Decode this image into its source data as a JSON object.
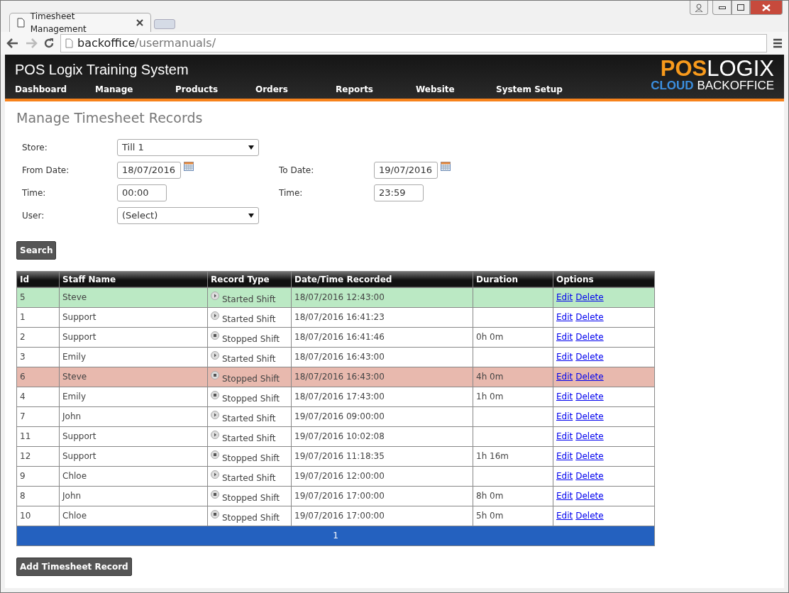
{
  "browser": {
    "tab_title": "Timesheet Management",
    "url_host": "backoffice",
    "url_path": "/usermanuals/"
  },
  "header": {
    "title": "POS Logix Training System",
    "logo": {
      "word_1": "POS",
      "word_2": "LOGIX",
      "word_3": "CLOUD",
      "word_4": "BACKOFFICE"
    },
    "nav": [
      "Dashboard",
      "Manage",
      "Products",
      "Orders",
      "Reports",
      "Website",
      "System Setup"
    ]
  },
  "page_title": "Manage Timesheet Records",
  "filters": {
    "store": {
      "label": "Store:",
      "value": "Till 1"
    },
    "from_date": {
      "label": "From Date:",
      "value": "18/07/2016"
    },
    "to_date": {
      "label": "To Date:",
      "value": "19/07/2016"
    },
    "from_time": {
      "label": "Time:",
      "value": "00:00"
    },
    "to_time": {
      "label": "Time:",
      "value": "23:59"
    },
    "user": {
      "label": "User:",
      "value": "(Select)"
    }
  },
  "search_button": "Search",
  "table": {
    "columns": [
      "Id",
      "Staff Name",
      "Record Type",
      "Date/Time Recorded",
      "Duration",
      "Options"
    ],
    "rows": [
      {
        "id": "5",
        "name": "Steve",
        "kind": "started",
        "type": "Started Shift",
        "recorded": "18/07/2016 12:43:00",
        "duration": "",
        "color": "#bbe9c4",
        "edit": "Edit",
        "delete": "Delete"
      },
      {
        "id": "1",
        "name": "Support",
        "kind": "started",
        "type": "Started Shift",
        "recorded": "18/07/2016 16:41:23",
        "duration": "",
        "color": "#ffffff",
        "edit": "Edit",
        "delete": "Delete"
      },
      {
        "id": "2",
        "name": "Support",
        "kind": "stopped",
        "type": "Stopped Shift",
        "recorded": "18/07/2016 16:41:46",
        "duration": "0h 0m",
        "color": "#ffffff",
        "edit": "Edit",
        "delete": "Delete"
      },
      {
        "id": "3",
        "name": "Emily",
        "kind": "started",
        "type": "Started Shift",
        "recorded": "18/07/2016 16:43:00",
        "duration": "",
        "color": "#ffffff",
        "edit": "Edit",
        "delete": "Delete"
      },
      {
        "id": "6",
        "name": "Steve",
        "kind": "stopped",
        "type": "Stopped Shift",
        "recorded": "18/07/2016 16:43:00",
        "duration": "4h 0m",
        "color": "#e8b9ae",
        "edit": "Edit",
        "delete": "Delete"
      },
      {
        "id": "4",
        "name": "Emily",
        "kind": "stopped",
        "type": "Stopped Shift",
        "recorded": "18/07/2016 17:43:00",
        "duration": "1h 0m",
        "color": "#ffffff",
        "edit": "Edit",
        "delete": "Delete"
      },
      {
        "id": "7",
        "name": "John",
        "kind": "started",
        "type": "Started Shift",
        "recorded": "19/07/2016 09:00:00",
        "duration": "",
        "color": "#ffffff",
        "edit": "Edit",
        "delete": "Delete"
      },
      {
        "id": "11",
        "name": "Support",
        "kind": "started",
        "type": "Started Shift",
        "recorded": "19/07/2016 10:02:08",
        "duration": "",
        "color": "#ffffff",
        "edit": "Edit",
        "delete": "Delete"
      },
      {
        "id": "12",
        "name": "Support",
        "kind": "stopped",
        "type": "Stopped Shift",
        "recorded": "19/07/2016 11:18:35",
        "duration": "1h 16m",
        "color": "#ffffff",
        "edit": "Edit",
        "delete": "Delete"
      },
      {
        "id": "9",
        "name": "Chloe",
        "kind": "started",
        "type": "Started Shift",
        "recorded": "19/07/2016 12:00:00",
        "duration": "",
        "color": "#ffffff",
        "edit": "Edit",
        "delete": "Delete"
      },
      {
        "id": "8",
        "name": "John",
        "kind": "stopped",
        "type": "Stopped Shift",
        "recorded": "19/07/2016 17:00:00",
        "duration": "8h 0m",
        "color": "#ffffff",
        "edit": "Edit",
        "delete": "Delete"
      },
      {
        "id": "10",
        "name": "Chloe",
        "kind": "stopped",
        "type": "Stopped Shift",
        "recorded": "19/07/2016 17:00:00",
        "duration": "5h 0m",
        "color": "#ffffff",
        "edit": "Edit",
        "delete": "Delete"
      }
    ],
    "pages": [
      {
        "label": "1",
        "selected": true
      }
    ]
  },
  "add_button": "Add Timesheet Record"
}
